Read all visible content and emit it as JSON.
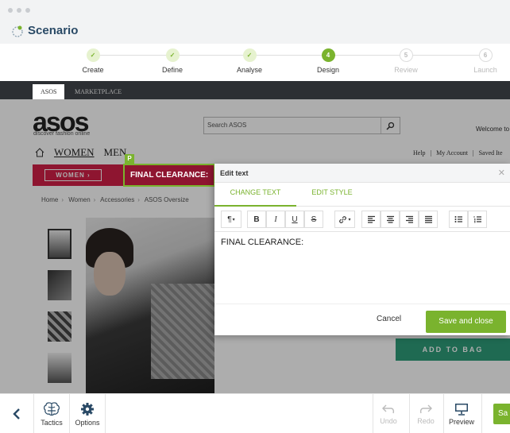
{
  "app": {
    "name": "Scenario"
  },
  "stepper": {
    "steps": [
      {
        "label": "Create",
        "state": "done"
      },
      {
        "label": "Define",
        "state": "done"
      },
      {
        "label": "Analyse",
        "state": "done"
      },
      {
        "label": "Design",
        "state": "active",
        "number": "4"
      },
      {
        "label": "Review",
        "state": "todo",
        "number": "5"
      },
      {
        "label": "Launch",
        "state": "todo",
        "number": "6"
      }
    ]
  },
  "site": {
    "tabs": [
      "ASOS",
      "MARKETPLACE"
    ],
    "logo": "asos",
    "tagline": "discover fashion online",
    "search_placeholder": "Search ASOS",
    "welcome": "Welcome to",
    "nav": {
      "women": "WOMEN",
      "men": "MEN"
    },
    "util_links": [
      "Help",
      "|",
      "My Account",
      "|",
      "Saved Ite"
    ],
    "women_button": "WOMEN ›",
    "promo_text": "FINAL CLEARANCE:",
    "edit_badge": "P",
    "breadcrumb": [
      "Home",
      "Women",
      "Accessories",
      "ASOS Oversize"
    ],
    "add_to_bag": "ADD TO BAG"
  },
  "dialog": {
    "title": "Edit text",
    "tabs": [
      "CHANGE TEXT",
      "EDIT STYLE"
    ],
    "toolbar": {
      "paragraph": "¶",
      "bold": "B",
      "italic": "I",
      "underline": "U",
      "strike": "S"
    },
    "content": "FINAL CLEARANCE:",
    "cancel": "Cancel",
    "save": "Save and close"
  },
  "bottombar": {
    "tactics": "Tactics",
    "options": "Options",
    "undo": "Undo",
    "redo": "Redo",
    "preview": "Preview",
    "save": "Sa"
  },
  "colors": {
    "accent": "#7ab32e",
    "promo": "#d21f47",
    "bag": "#2f9c7a"
  }
}
